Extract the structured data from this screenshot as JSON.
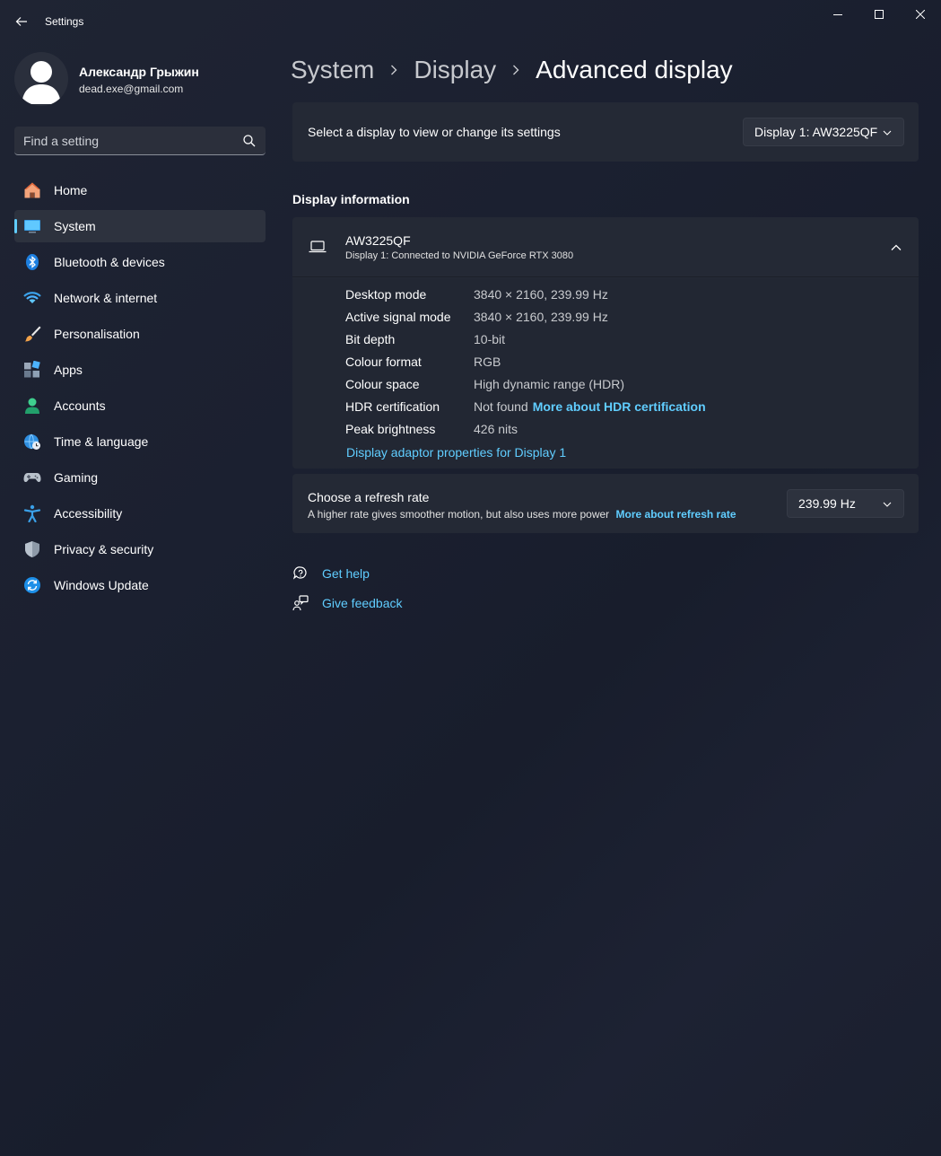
{
  "window": {
    "title": "Settings"
  },
  "profile": {
    "name": "Александр Грыжин",
    "email": "dead.exe@gmail.com"
  },
  "search": {
    "placeholder": "Find a setting"
  },
  "nav": {
    "items": [
      {
        "label": "Home",
        "icon": "home-icon"
      },
      {
        "label": "System",
        "icon": "system-icon",
        "active": true
      },
      {
        "label": "Bluetooth & devices",
        "icon": "bluetooth-icon"
      },
      {
        "label": "Network & internet",
        "icon": "wifi-icon"
      },
      {
        "label": "Personalisation",
        "icon": "brush-icon"
      },
      {
        "label": "Apps",
        "icon": "apps-icon"
      },
      {
        "label": "Accounts",
        "icon": "account-icon"
      },
      {
        "label": "Time & language",
        "icon": "globe-clock-icon"
      },
      {
        "label": "Gaming",
        "icon": "gamepad-icon"
      },
      {
        "label": "Accessibility",
        "icon": "accessibility-icon"
      },
      {
        "label": "Privacy & security",
        "icon": "shield-icon"
      },
      {
        "label": "Windows Update",
        "icon": "update-icon"
      }
    ]
  },
  "breadcrumb": {
    "items": [
      "System",
      "Display",
      "Advanced display"
    ]
  },
  "display_select": {
    "label": "Select a display to view or change its settings",
    "value": "Display 1: AW3225QF"
  },
  "display_info": {
    "section_title": "Display information",
    "monitor_name": "AW3225QF",
    "monitor_sub": "Display 1: Connected to NVIDIA GeForce RTX 3080",
    "rows": [
      {
        "label": "Desktop mode",
        "value": "3840 × 2160, 239.99 Hz"
      },
      {
        "label": "Active signal mode",
        "value": "3840 × 2160, 239.99 Hz"
      },
      {
        "label": "Bit depth",
        "value": "10-bit"
      },
      {
        "label": "Colour format",
        "value": "RGB"
      },
      {
        "label": "Colour space",
        "value": "High dynamic range (HDR)"
      },
      {
        "label": "HDR certification",
        "value": "Not found",
        "link": "More about HDR certification"
      },
      {
        "label": "Peak brightness",
        "value": "426 nits"
      }
    ],
    "adaptor_link": "Display adaptor properties for Display 1"
  },
  "refresh_rate": {
    "title": "Choose a refresh rate",
    "description": "A higher rate gives smoother motion, but also uses more power",
    "link": "More about refresh rate",
    "value": "239.99 Hz"
  },
  "help": {
    "get_help": "Get help",
    "give_feedback": "Give feedback"
  },
  "colors": {
    "accent": "#60cdff",
    "card": "#242935",
    "background": "#1b2030"
  }
}
